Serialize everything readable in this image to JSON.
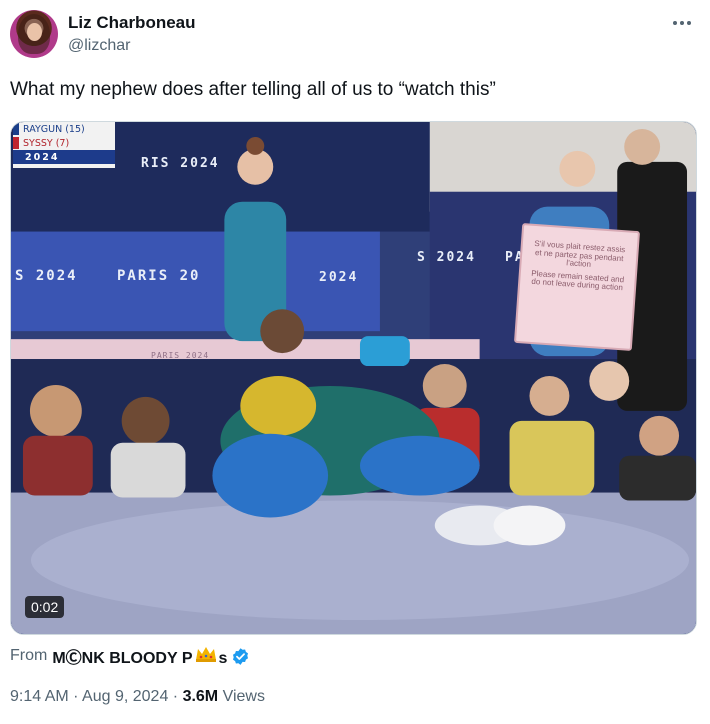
{
  "author": {
    "name": "Liz Charboneau",
    "handle": "@lizchar"
  },
  "tweet": {
    "text": "What my nephew does after telling all of us to “watch this”"
  },
  "video": {
    "duration": "0:02",
    "scoreboard": {
      "row1": "RAYGUN (15)",
      "row2": "SYSSY (7)",
      "row3": "2024"
    },
    "banners": [
      "PARIS 2024",
      "S 2024",
      "PARIS 20",
      "2024",
      "RIS 2024",
      "S 2024",
      "PA",
      "PARIS 2024"
    ],
    "sign": {
      "french": "S'il vous plait restez assis et ne partez pas pendant l'action",
      "english": "Please remain seated and do not leave during action"
    }
  },
  "source": {
    "prefix": "From",
    "name_part1": "MⒸNK BLOODY P",
    "name_part2": "s"
  },
  "meta": {
    "time": "9:14 AM",
    "separator1": " · ",
    "date": "Aug 9, 2024",
    "separator2": " · ",
    "views_count": "3.6M",
    "views_label": " Views"
  },
  "colors": {
    "accent": "#1d9bf0",
    "secondary_text": "#536471",
    "primary_text": "#0f1419"
  }
}
